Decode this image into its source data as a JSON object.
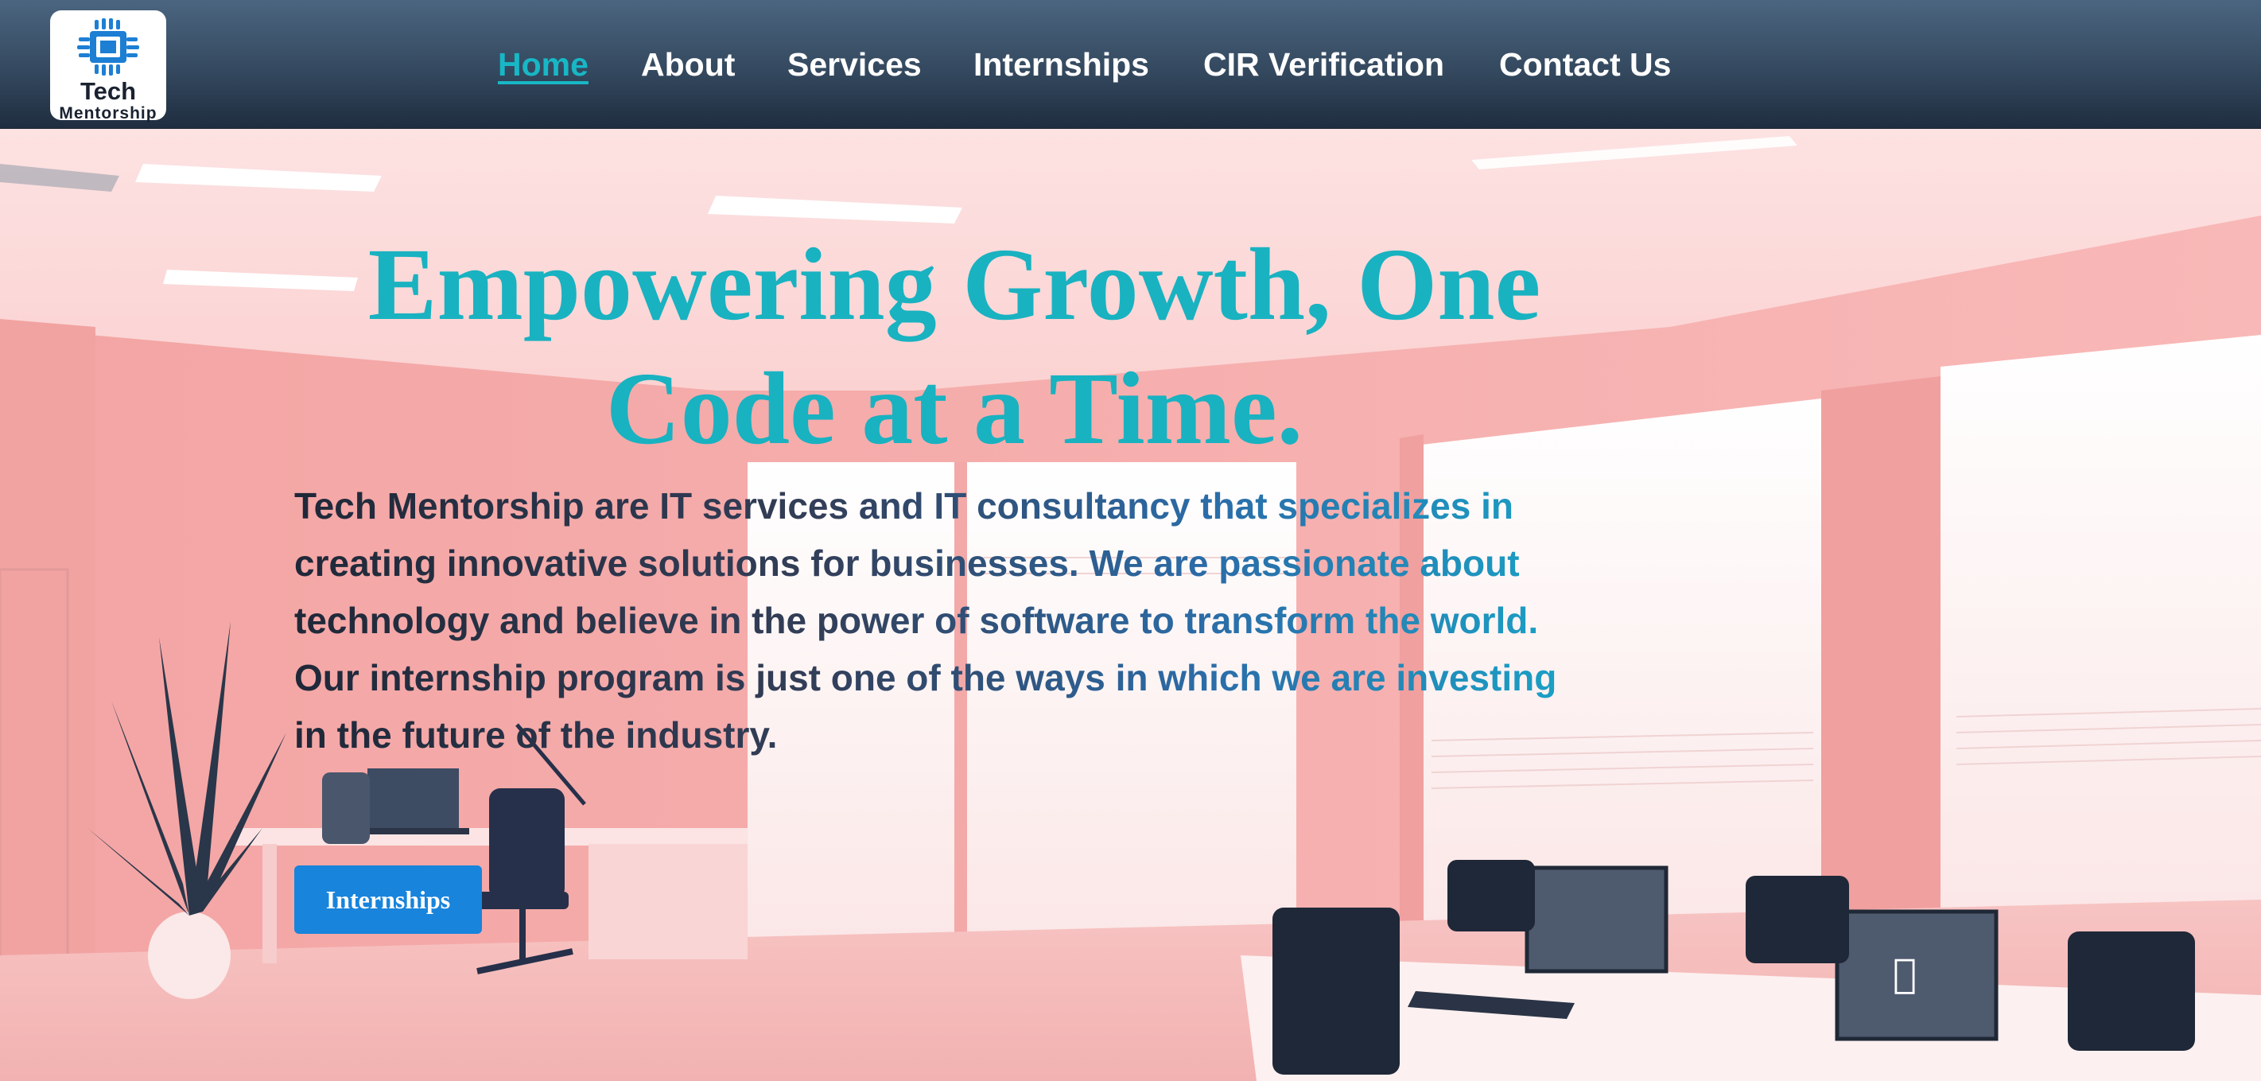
{
  "brand": {
    "logo_line1": "Tech",
    "logo_line2": "Mentorship",
    "logo_icon": "cpu-chip-icon",
    "accent_color": "#19b2c1",
    "button_color": "#1884dc"
  },
  "nav": {
    "items": [
      {
        "label": "Home",
        "active": true
      },
      {
        "label": "About",
        "active": false
      },
      {
        "label": "Services",
        "active": false
      },
      {
        "label": "Internships",
        "active": false
      },
      {
        "label": "CIR Verification",
        "active": false
      },
      {
        "label": "Contact Us",
        "active": false
      }
    ]
  },
  "hero": {
    "headline_line1": "Empowering Growth, One",
    "headline_line2": "Code at a Time.",
    "intro": "Tech Mentorship are IT services and IT consultancy that specializes in creating innovative solutions for businesses. We are passionate about technology and believe in the power of software to transform the world. Our internship program is just one of the ways in which we are investing in the future of the industry.",
    "cta_label": "Internships",
    "background": "pink-office-photo"
  }
}
